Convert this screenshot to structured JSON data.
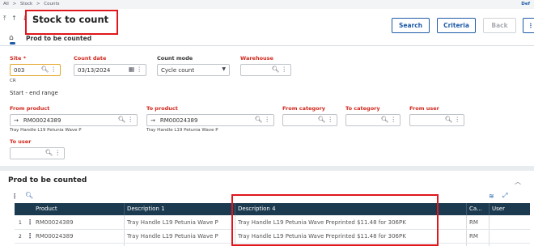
{
  "breadcrumb": [
    "All",
    ">",
    "Stock",
    ">",
    "Counts"
  ],
  "breadcrumb_right": "Def",
  "header": {
    "arrows": "⤒ ↑ ↓ ⤓",
    "title": "Stock to count",
    "buttons": {
      "search": "Search",
      "criteria": "Criteria",
      "back": "Back"
    },
    "home_icon": "⌂",
    "subtitle": "Prod to be counted"
  },
  "form": {
    "site": {
      "label": "Site *",
      "value": "003",
      "note": "CR"
    },
    "count_date": {
      "label": "Count date",
      "value": "03/13/2024"
    },
    "count_mode": {
      "label": "Count mode",
      "value": "Cycle count"
    },
    "warehouse": {
      "label": "Warehouse",
      "value": ""
    },
    "range_title": "Start - end range",
    "from_product": {
      "label": "From product",
      "value": "RM00024389",
      "desc": "Tray Handle L19 Petunia Wave P"
    },
    "to_product": {
      "label": "To product",
      "value": "RM00024389",
      "desc": "Tray Handle L19 Petunia Wave P"
    },
    "from_category": {
      "label": "From category",
      "value": ""
    },
    "to_category": {
      "label": "To category",
      "value": ""
    },
    "from_user": {
      "label": "From user",
      "value": ""
    },
    "to_user": {
      "label": "To user",
      "value": ""
    }
  },
  "grid": {
    "title": "Prod to be counted",
    "columns": [
      "Product",
      "Description 1",
      "Description 4",
      "Ca...",
      "User"
    ],
    "rows": [
      {
        "num": "1",
        "product": "RM00024389",
        "desc1": "Tray Handle L19 Petunia Wave P",
        "desc4": "Tray Handle L19 Petunia Wave Preprinted $11.48 for 306PK",
        "cat": "RM",
        "user": ""
      },
      {
        "num": "2",
        "product": "RM00024389",
        "desc1": "Tray Handle L19 Petunia Wave P",
        "desc4": "Tray Handle L19 Petunia Wave Preprinted $11.48 for 306PK",
        "cat": "RM",
        "user": ""
      }
    ]
  },
  "colors": {
    "accent": "#1d5aa8",
    "required": "#d0281d",
    "highlight": "#e0161d",
    "grid_header": "#1c3a4f"
  }
}
